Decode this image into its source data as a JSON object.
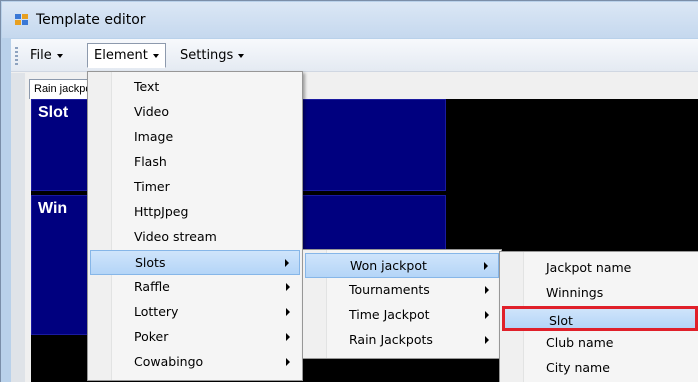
{
  "window": {
    "title": "Template editor"
  },
  "menubar": [
    {
      "label": "File"
    },
    {
      "label": "Element"
    },
    {
      "label": "Settings"
    }
  ],
  "tab": {
    "label": "Rain jackpot"
  },
  "canvas": {
    "panels": [
      {
        "label": "Slot"
      },
      {
        "label": "Win"
      }
    ]
  },
  "element_menu": [
    {
      "label": "Text",
      "submenu": false
    },
    {
      "label": "Video",
      "submenu": false
    },
    {
      "label": "Image",
      "submenu": false
    },
    {
      "label": "Flash",
      "submenu": false
    },
    {
      "label": "Timer",
      "submenu": false
    },
    {
      "label": "HttpJpeg",
      "submenu": false
    },
    {
      "label": "Video stream",
      "submenu": false
    },
    {
      "label": "Slots",
      "submenu": true
    },
    {
      "label": "Raffle",
      "submenu": true
    },
    {
      "label": "Lottery",
      "submenu": true
    },
    {
      "label": "Poker",
      "submenu": true
    },
    {
      "label": "Cowabingo",
      "submenu": true
    }
  ],
  "slots_menu": [
    {
      "label": "Won jackpot",
      "submenu": true
    },
    {
      "label": "Tournaments",
      "submenu": true
    },
    {
      "label": "Time Jackpot",
      "submenu": true
    },
    {
      "label": "Rain Jackpots",
      "submenu": true
    }
  ],
  "won_jackpot_menu": [
    {
      "label": "Jackpot name"
    },
    {
      "label": "Winnings"
    },
    {
      "label": "Slot"
    },
    {
      "label": "Club name"
    },
    {
      "label": "City name"
    }
  ],
  "colors": {
    "canvas_bg": "#000000",
    "panel_blue": "#00007f",
    "highlight_border": "#e0202a"
  }
}
